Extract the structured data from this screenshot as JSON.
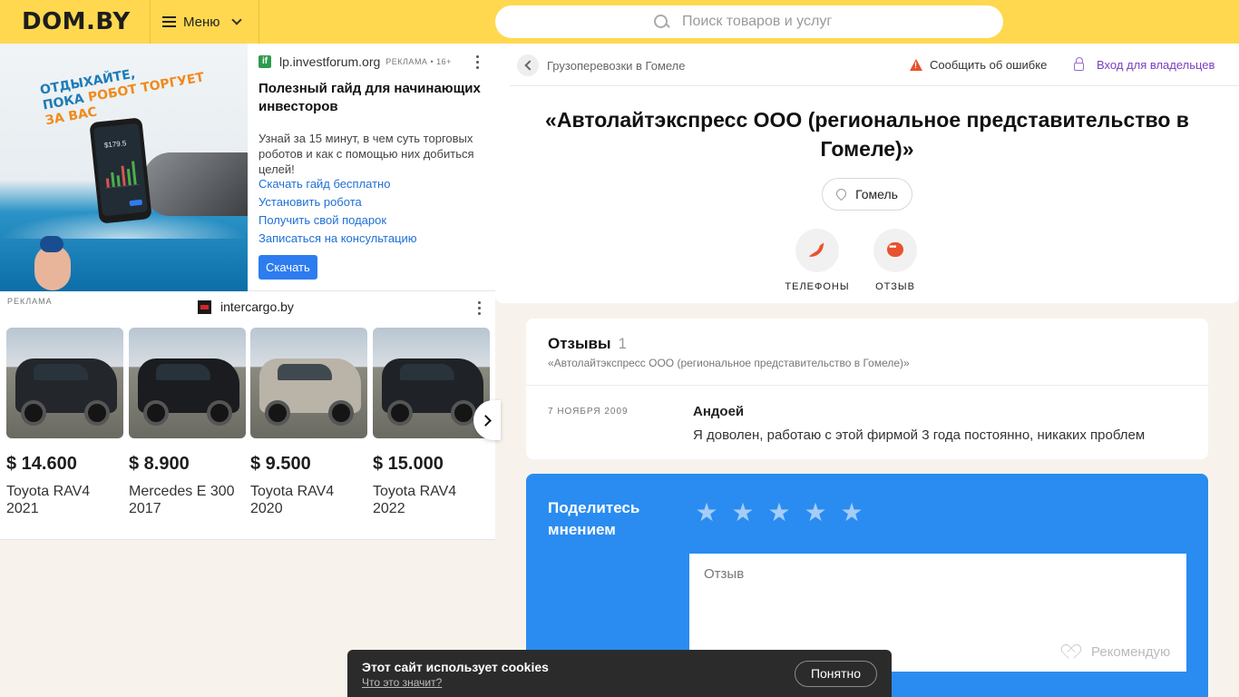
{
  "header": {
    "logo": "DOM.BY",
    "menu_label": "Меню",
    "search_placeholder": "Поиск товаров и услуг"
  },
  "ad_investforum": {
    "image_text_line1": "ОТДЫХАЙТЕ,",
    "image_text_line2a": "ПОКА ",
    "image_text_line2b": "РОБОТ ТОРГУЕТ",
    "image_text_line3": "ЗА ВАС",
    "phone_value": "$179.5",
    "domain": "lp.investforum.org",
    "tag": "РЕКЛАМА • 16+",
    "title": "Полезный гайд для начинающих инвесторов",
    "description": "Узнай за 15 минут, в чем суть торговых роботов и как с помощью них добиться целей!",
    "links": [
      "Скачать гайд бесплатно",
      "Установить робота",
      "Получить свой подарок",
      "Записаться на консультацию"
    ],
    "cta": "Скачать"
  },
  "ad_intercargo": {
    "label": "РЕКЛАМА",
    "domain": "intercargo.by",
    "cars": [
      {
        "price": "$ 14.600",
        "name": "Toyota RAV4 2021",
        "color": "#23262b"
      },
      {
        "price": "$ 8.900",
        "name": "Mercedes E 300 2017",
        "color": "#1a1c20"
      },
      {
        "price": "$ 9.500",
        "name": "Toyota RAV4 2020",
        "color": "#b9b3a8"
      },
      {
        "price": "$ 15.000",
        "name": "Toyota RAV4 2022",
        "color": "#1f2226"
      }
    ]
  },
  "company": {
    "breadcrumb": "Грузоперевозки в Гомеле",
    "report_label": "Сообщить об ошибке",
    "owners_label": "Вход для владельцев",
    "title": "«Автолайтэкспресс ООО (региональное представительство в Гомеле)»",
    "city": "Гомель",
    "actions": {
      "phones": "ТЕЛЕФОНЫ",
      "review": "ОТЗЫВ"
    }
  },
  "reviews": {
    "title": "Отзывы",
    "count": "1",
    "subtitle": "«Автолайтэкспресс ООО (региональное представительство в Гомеле)»",
    "items": [
      {
        "date": "7 НОЯБРЯ 2009",
        "author": "Андоей",
        "text": "Я доволен, работаю с этой фирмой 3 года постоянно, никаких проблем"
      }
    ]
  },
  "share": {
    "title": "Поделитесь мнением",
    "rating_max": 5,
    "review_placeholder": "Отзыв",
    "recommend_label": "Рекомендую"
  },
  "cookie": {
    "title": "Этот сайт использует cookies",
    "link": "Что это значит?",
    "button": "Понятно"
  }
}
